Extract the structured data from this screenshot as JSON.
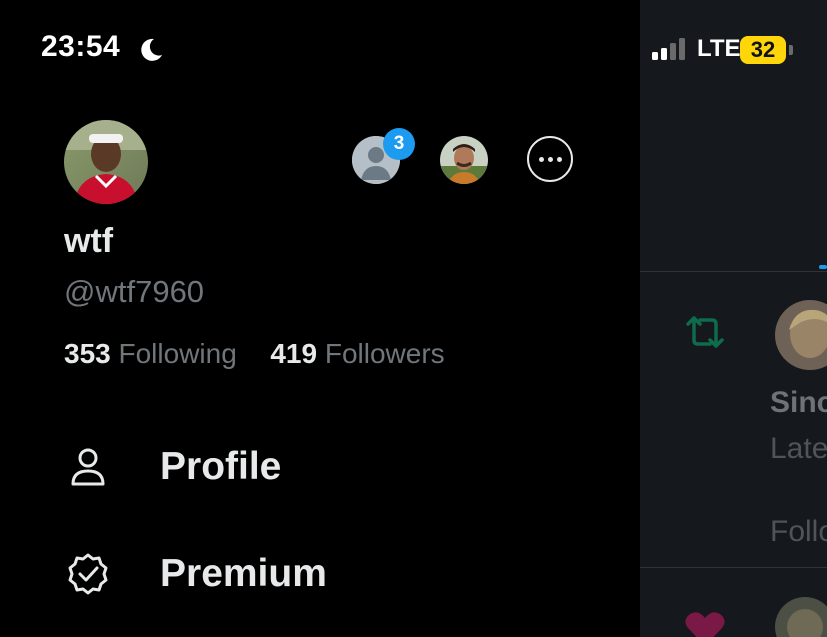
{
  "status_bar": {
    "time": "23:54",
    "network": "LTE",
    "battery": "32"
  },
  "drawer": {
    "user": {
      "display_name": "wtf",
      "handle": "@wtf7960",
      "following_count": "353",
      "following_label": "Following",
      "followers_count": "419",
      "followers_label": "Followers"
    },
    "accounts": {
      "notification_badge": "3"
    },
    "menu": [
      {
        "label": "Profile",
        "icon": "person-icon"
      },
      {
        "label": "Premium",
        "icon": "verified-badge-icon"
      }
    ]
  },
  "background_feed": {
    "name_partial": "Sinc",
    "subtitle_partial": "Late",
    "follow_partial": "Follo"
  },
  "colors": {
    "accent": "#1d9bf0",
    "text_primary": "#e7e9ea",
    "text_secondary": "#71767b",
    "retweet_green": "#00ba7c",
    "like_pink": "#f91880",
    "battery_low": "#ffd60a"
  }
}
